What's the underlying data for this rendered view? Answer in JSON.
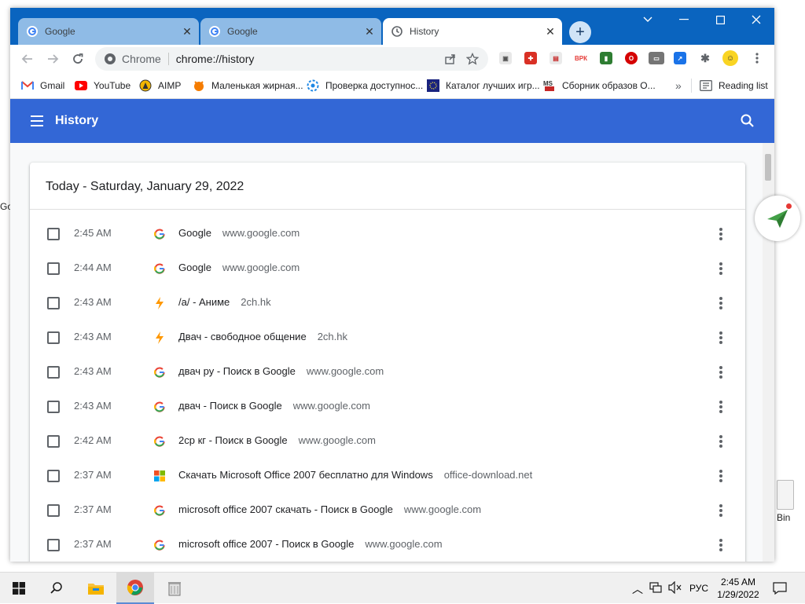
{
  "desktop": {
    "left_label": "Go",
    "bin_label": "Bin"
  },
  "tabs": [
    {
      "title": "Google",
      "icon": "google-g-icon",
      "active": false
    },
    {
      "title": "Google",
      "icon": "google-g-icon",
      "active": false
    },
    {
      "title": "History",
      "icon": "history-clock-icon",
      "active": true
    }
  ],
  "window_controls": [
    "chevron-down-icon",
    "minimize-icon",
    "maximize-icon",
    "close-icon"
  ],
  "omnibox": {
    "chip": "Chrome",
    "url": "chrome://history"
  },
  "bookmarks": [
    {
      "label": "Gmail",
      "icon": "gmail-icon"
    },
    {
      "label": "YouTube",
      "icon": "youtube-icon"
    },
    {
      "label": "AIMP",
      "icon": "aimp-icon"
    },
    {
      "label": "Маленькая жирная...",
      "icon": "fox-icon"
    },
    {
      "label": "Проверка доступнос...",
      "icon": "gear-icon"
    },
    {
      "label": "Каталог лучших игр...",
      "icon": "catalog-icon"
    },
    {
      "label": "Сборник образов О...",
      "icon": "ms-icon"
    }
  ],
  "reading_list": "Reading list",
  "header": {
    "title": "History"
  },
  "history": {
    "date_heading": "Today - Saturday, January 29, 2022",
    "rows": [
      {
        "time": "2:45 AM",
        "title": "Google",
        "domain": "www.google.com",
        "favicon": "google"
      },
      {
        "time": "2:44 AM",
        "title": "Google",
        "domain": "www.google.com",
        "favicon": "google"
      },
      {
        "time": "2:43 AM",
        "title": "/a/ - Аниме",
        "domain": "2ch.hk",
        "favicon": "2ch"
      },
      {
        "time": "2:43 AM",
        "title": "Двач - свободное общение",
        "domain": "2ch.hk",
        "favicon": "2ch"
      },
      {
        "time": "2:43 AM",
        "title": "двач ру - Поиск в Google",
        "domain": "www.google.com",
        "favicon": "google"
      },
      {
        "time": "2:43 AM",
        "title": "двач - Поиск в Google",
        "domain": "www.google.com",
        "favicon": "google"
      },
      {
        "time": "2:42 AM",
        "title": "2ср кг - Поиск в Google",
        "domain": "www.google.com",
        "favicon": "google"
      },
      {
        "time": "2:37 AM",
        "title": "Скачать Microsoft Office 2007 бесплатно для Windows",
        "domain": "office-download.net",
        "favicon": "ms"
      },
      {
        "time": "2:37 AM",
        "title": "microsoft office 2007 скачать - Поиск в Google",
        "domain": "www.google.com",
        "favicon": "google"
      },
      {
        "time": "2:37 AM",
        "title": "microsoft office 2007 - Поиск в Google",
        "domain": "www.google.com",
        "favicon": "google"
      }
    ]
  },
  "taskbar": {
    "lang": "РУС",
    "time": "2:45 AM",
    "date": "1/29/2022"
  },
  "colors": {
    "tabstrip": "#0a64bf",
    "header": "#3367d6",
    "chrome_red": "#db4437",
    "chrome_yellow": "#f4b400",
    "chrome_green": "#0f9d58",
    "chrome_blue": "#4285f4"
  }
}
